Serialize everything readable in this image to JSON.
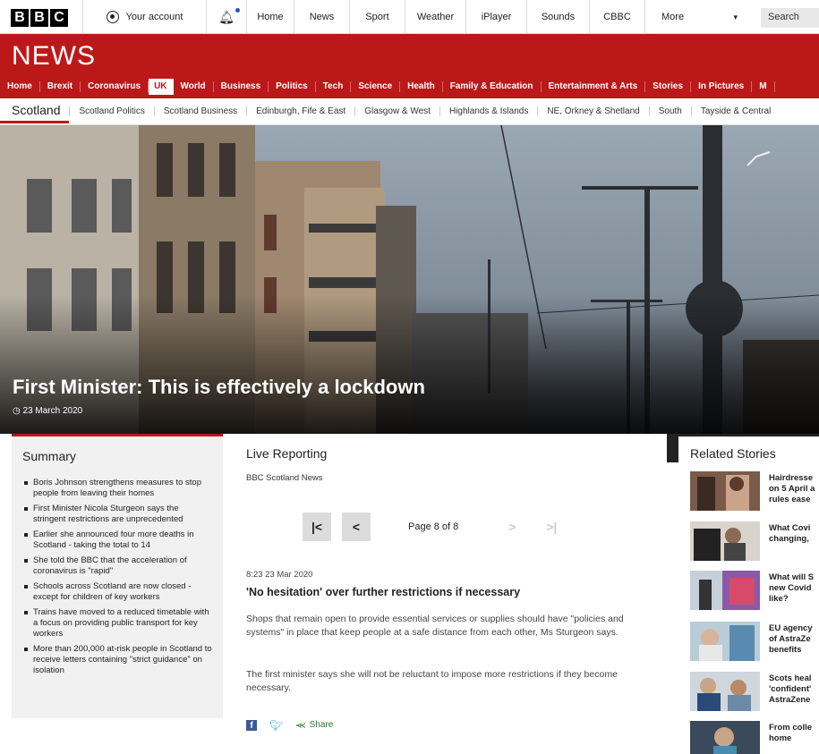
{
  "topbar": {
    "logo_letters": [
      "B",
      "B",
      "C"
    ],
    "account_label": "Your account",
    "nav": [
      "Home",
      "News",
      "Sport",
      "Weather",
      "iPlayer",
      "Sounds",
      "CBBC",
      "More"
    ],
    "search_placeholder": "Search"
  },
  "news": {
    "title": "NEWS",
    "nav": [
      "Home",
      "Brexit",
      "Coronavirus",
      "UK",
      "World",
      "Business",
      "Politics",
      "Tech",
      "Science",
      "Health",
      "Family & Education",
      "Entertainment & Arts",
      "Stories",
      "In Pictures",
      "M"
    ],
    "active": "UK"
  },
  "subnav": {
    "region": "Scotland",
    "items": [
      "Scotland Politics",
      "Scotland Business",
      "Edinburgh, Fife & East",
      "Glasgow & West",
      "Highlands & Islands",
      "NE, Orkney & Shetland",
      "South",
      "Tayside & Central"
    ]
  },
  "hero": {
    "title": "First Minister: This is effectively a lockdown",
    "date": "23 March 2020"
  },
  "summary": {
    "title": "Summary",
    "items": [
      "Boris Johnson strengthens measures to stop people from leaving their homes",
      "First Minister Nicola Sturgeon says the stringent restrictions are unprecedented",
      "Earlier she announced four more deaths in Scotland - taking the total to 14",
      "She told the BBC that the acceleration of coronavirus is \"rapid\"",
      "Schools across Scotland are now closed - except for children of key workers",
      "Trains have moved to a reduced timetable with a focus on providing public transport for key workers",
      "More than 200,000 at-risk people in Scotland to receive letters containing \"strict guidance\" on isolation"
    ]
  },
  "live": {
    "title": "Live Reporting",
    "source": "BBC Scotland News",
    "pager": {
      "first": "|<",
      "prev": "<",
      "label": "Page 8 of 8",
      "next": ">",
      "last": ">|"
    },
    "entry": {
      "time": "8:23 23 Mar 2020",
      "title": "'No hesitation' over further restrictions if necessary",
      "paragraphs": [
        "Shops that remain open to provide essential services or supplies should have \"policies and systems\" in place that keep people at a safe distance from each other, Ms Sturgeon says.",
        "The first minister says she will not be reluctant to impose more restrictions if they become necessary."
      ]
    },
    "share_label": "Share"
  },
  "related": {
    "title": "Related Stories",
    "items": [
      "Hairdresse\non 5 April a\nrules ease",
      "What Covi\nchanging,",
      "What will S\nnew Covid\nlike?",
      "EU agency\nof AstraZe\nbenefits",
      "Scots heal\n'confident'\nAstraZene",
      "From colle\nhome"
    ]
  },
  "colors": {
    "bbc_red": "#bb1919",
    "dark": "#222222"
  }
}
